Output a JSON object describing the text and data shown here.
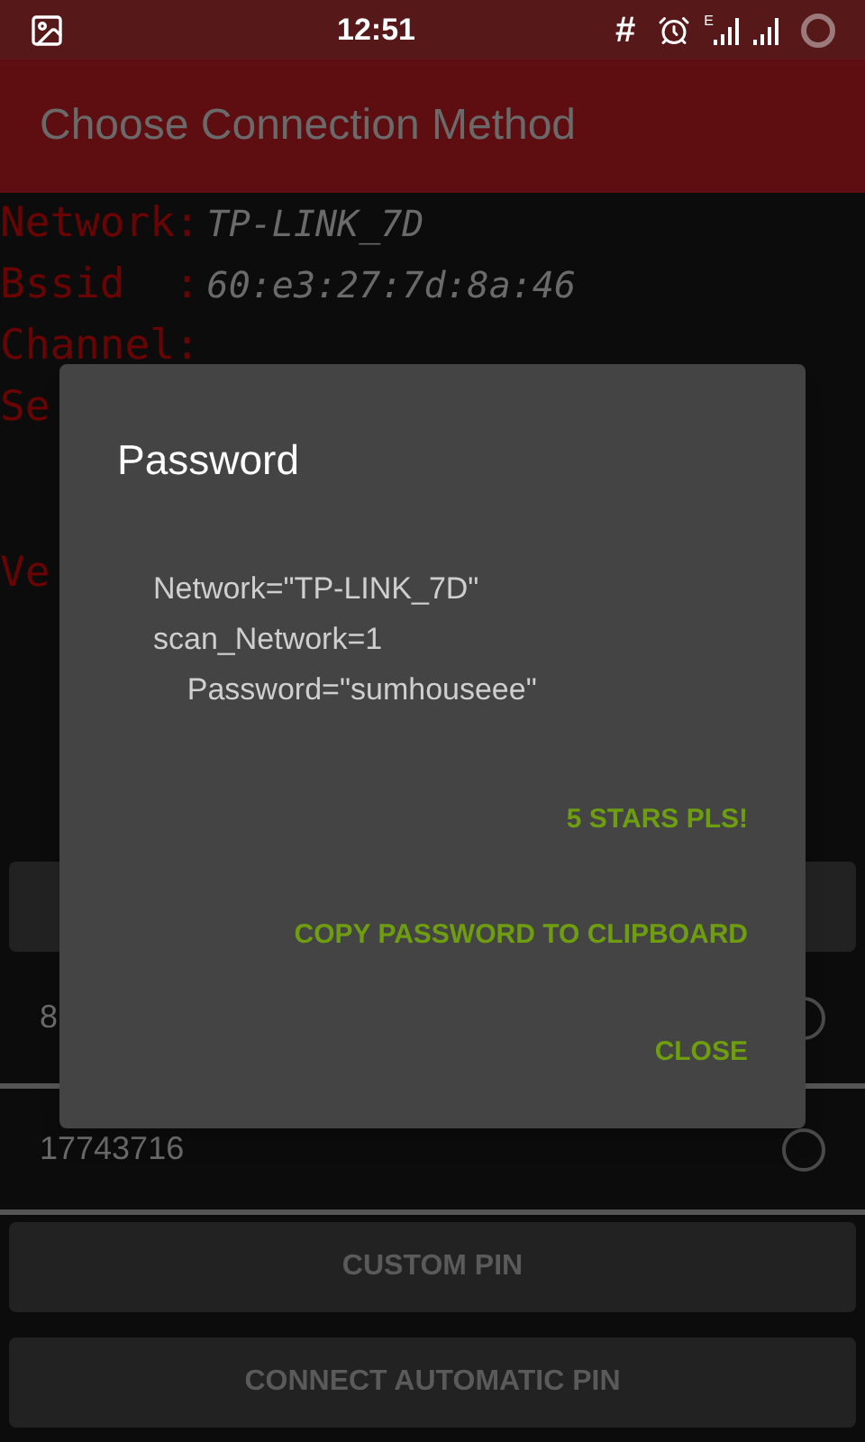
{
  "status_bar": {
    "time": "12:51",
    "indicator": "#",
    "network_type": "E"
  },
  "app_bar": {
    "title": "Choose Connection Method"
  },
  "info": [
    {
      "label": "Network:",
      "value": "TP-LINK_7D"
    },
    {
      "label": "Bssid  :",
      "value": "60:e3:27:7d:8a:46"
    },
    {
      "label": "Channel:"
    },
    {
      "label": "Se"
    }
  ],
  "version": {
    "label": "Ve"
  },
  "pins": [
    {
      "value": "8",
      "selected": false
    },
    {
      "value": "17743716",
      "selected": false
    }
  ],
  "buttons": [
    "CUSTOM PIN",
    "CONNECT AUTOMATIC PIN"
  ],
  "dialog": {
    "title": "Password",
    "lines": [
      "Network=\"TP-LINK_7D\"",
      "scan_Network=1",
      "    Password=\"sumhouseee\""
    ],
    "actions": [
      "5 STARS PLS!",
      "COPY PASSWORD TO CLIPBOARD",
      "CLOSE"
    ]
  }
}
